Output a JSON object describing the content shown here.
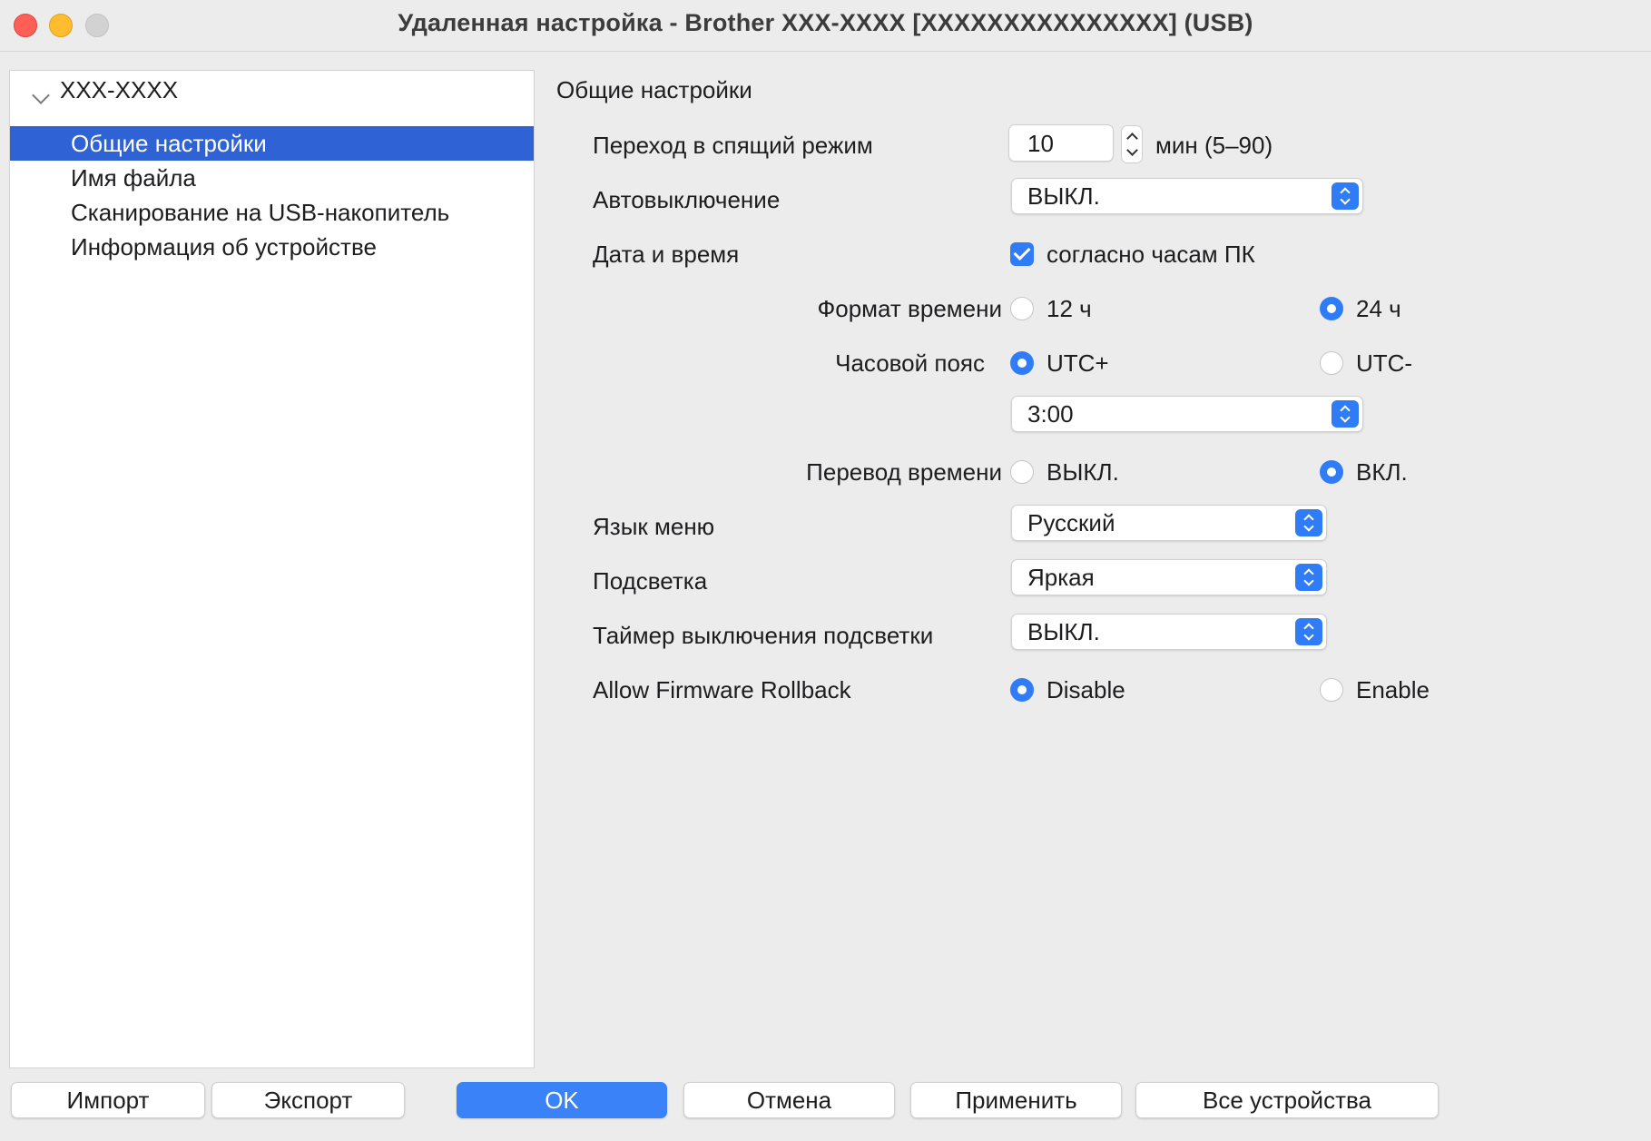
{
  "window": {
    "title": "Удаленная настройка - Brother XXX-XXXX    [XXXXXXXXXXXXXXX]  (USB)"
  },
  "sidebar": {
    "root": "XXX-XXXX",
    "items": [
      {
        "label": "Общие настройки",
        "selected": true
      },
      {
        "label": "Имя файла",
        "selected": false
      },
      {
        "label": "Сканирование на USB-накопитель",
        "selected": false
      },
      {
        "label": "Информация об устройстве",
        "selected": false
      }
    ]
  },
  "main": {
    "section_title": "Общие настройки",
    "sleep": {
      "label": "Переход в спящий режим",
      "value": "10",
      "unit": "мин (5–90)"
    },
    "auto_off": {
      "label": "Автовыключение",
      "value": "ВЫКЛ."
    },
    "datetime": {
      "label": "Дата и время",
      "checkbox_label": "согласно часам ПК",
      "checked": true
    },
    "time_format": {
      "label": "Формат времени",
      "opt1": "12 ч",
      "opt2": "24 ч",
      "selected": "24 ч"
    },
    "timezone": {
      "label": "Часовой пояс",
      "opt1": "UTC+",
      "opt2": "UTC-",
      "selected": "UTC+",
      "offset": "3:00"
    },
    "dst": {
      "label": "Перевод времени",
      "opt1": "ВЫКЛ.",
      "opt2": "ВКЛ.",
      "selected": "ВКЛ."
    },
    "language": {
      "label": "Язык меню",
      "value": "Русский"
    },
    "backlight": {
      "label": "Подсветка",
      "value": "Яркая"
    },
    "backlight_timer": {
      "label": "Таймер выключения подсветки",
      "value": "ВЫКЛ."
    },
    "firmware_rollback": {
      "label": "Allow Firmware Rollback",
      "opt1": "Disable",
      "opt2": "Enable",
      "selected": "Disable"
    }
  },
  "buttons": {
    "import": "Импорт",
    "export": "Экспорт",
    "ok": "OK",
    "cancel": "Отмена",
    "apply": "Применить",
    "all_devices": "Все устройства"
  },
  "colors": {
    "accent": "#2f7cf6",
    "selection": "#2f62d4"
  }
}
